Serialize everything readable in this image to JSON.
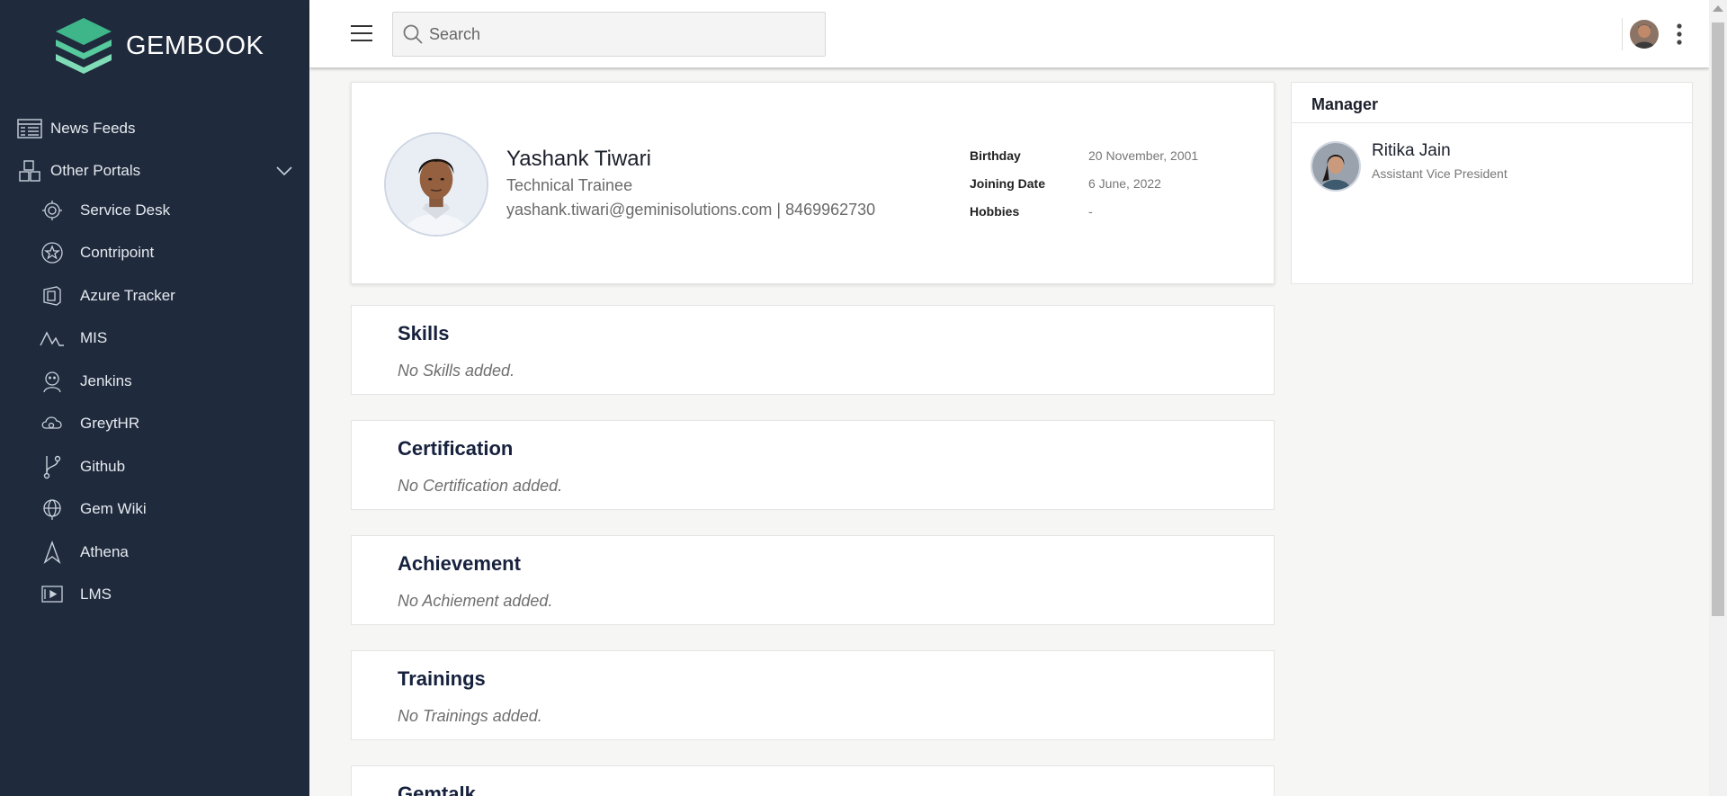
{
  "brand": {
    "name": "GEMBOOK"
  },
  "sidebar": {
    "top_items": [
      {
        "label": "News Feeds",
        "icon": "news-feed-icon"
      },
      {
        "label": "Other Portals",
        "icon": "portals-icon"
      }
    ],
    "portals": [
      {
        "label": "Service Desk",
        "icon": "gear-icon"
      },
      {
        "label": "Contripoint",
        "icon": "star-icon"
      },
      {
        "label": "Azure Tracker",
        "icon": "azure-icon"
      },
      {
        "label": "MIS",
        "icon": "chart-line-icon"
      },
      {
        "label": "Jenkins",
        "icon": "jenkins-icon"
      },
      {
        "label": "GreytHR",
        "icon": "cloud-icon"
      },
      {
        "label": "Github",
        "icon": "git-branch-icon"
      },
      {
        "label": "Gem Wiki",
        "icon": "globe-icon"
      },
      {
        "label": "Athena",
        "icon": "athena-icon"
      },
      {
        "label": "LMS",
        "icon": "lms-icon"
      }
    ]
  },
  "topbar": {
    "search_placeholder": "Search"
  },
  "profile": {
    "name": "Yashank Tiwari",
    "role": "Technical Trainee",
    "contact": "yashank.tiwari@geminisolutions.com | 8469962730",
    "details": [
      {
        "label": "Birthday",
        "value": "20 November, 2001"
      },
      {
        "label": "Joining Date",
        "value": "6 June, 2022"
      },
      {
        "label": "Hobbies",
        "value": "-"
      }
    ]
  },
  "manager": {
    "title": "Manager",
    "name": "Ritika Jain",
    "role": "Assistant Vice President"
  },
  "sections": [
    {
      "title": "Skills",
      "empty": "No Skills added."
    },
    {
      "title": "Certification",
      "empty": "No Certification added."
    },
    {
      "title": "Achievement",
      "empty": "No Achiement added."
    },
    {
      "title": "Trainings",
      "empty": "No Trainings added."
    },
    {
      "title": "Gemtalk",
      "empty": ""
    }
  ],
  "colors": {
    "sidebar_bg": "#1f2a3c",
    "logo_green": "#3fbf8f",
    "heading_navy": "#16213d"
  }
}
